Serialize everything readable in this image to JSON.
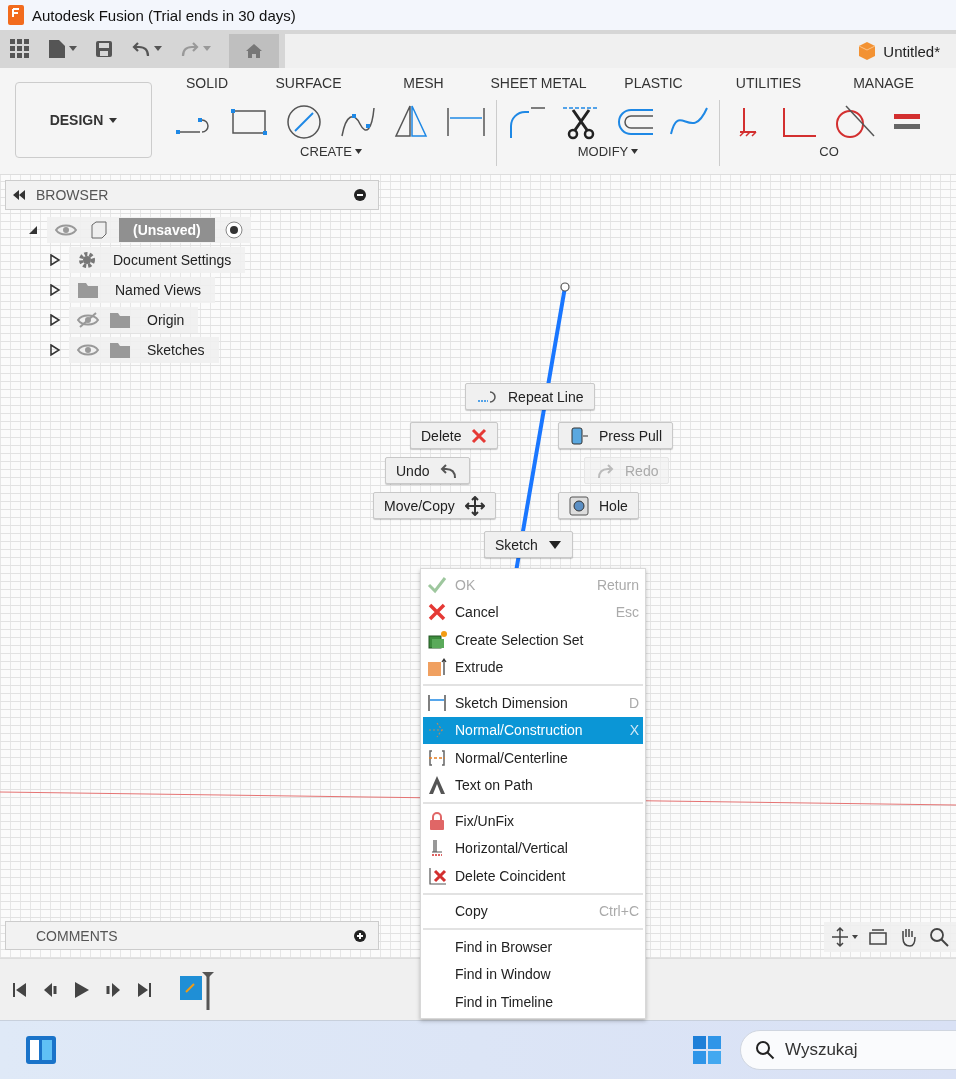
{
  "window": {
    "title": "Autodesk Fusion (Trial ends in 30 days)"
  },
  "document_tab": {
    "title": "Untitled*"
  },
  "workspace": {
    "label": "DESIGN"
  },
  "toolbar_tabs": [
    "SOLID",
    "SURFACE",
    "MESH",
    "SHEET METAL",
    "PLASTIC",
    "UTILITIES",
    "MANAGE"
  ],
  "toolbar_groups": [
    {
      "label": "CREATE"
    },
    {
      "label": "MODIFY"
    },
    {
      "label": "CO"
    }
  ],
  "browser": {
    "title": "BROWSER",
    "root": {
      "label": "(Unsaved)",
      "visible": true,
      "active": true,
      "expanded": true,
      "children": [
        {
          "label": "Document Settings",
          "expanded": false
        },
        {
          "label": "Named Views",
          "expanded": false
        },
        {
          "label": "Origin",
          "expanded": false,
          "visible": false
        },
        {
          "label": "Sketches",
          "expanded": false,
          "visible": true
        }
      ]
    }
  },
  "marking_menu": [
    {
      "label": "Repeat Line",
      "disabled": false
    },
    {
      "label": "Delete",
      "disabled": false
    },
    {
      "label": "Press Pull",
      "disabled": false
    },
    {
      "label": "Undo",
      "disabled": false
    },
    {
      "label": "Redo",
      "disabled": true
    },
    {
      "label": "Move/Copy",
      "disabled": false
    },
    {
      "label": "Hole",
      "disabled": false
    },
    {
      "label": "Sketch",
      "disabled": false
    }
  ],
  "context_menu": [
    [
      {
        "label": "OK",
        "shortcut": "Return",
        "disabled": true,
        "selected": false
      },
      {
        "label": "Cancel",
        "shortcut": "Esc",
        "disabled": false,
        "selected": false
      },
      {
        "label": "Create Selection Set",
        "disabled": false,
        "selected": false
      },
      {
        "label": "Extrude",
        "disabled": false,
        "selected": false
      }
    ],
    [
      {
        "label": "Sketch Dimension",
        "shortcut": "D",
        "disabled": false,
        "selected": false
      },
      {
        "label": "Normal/Construction",
        "shortcut": "X",
        "disabled": false,
        "selected": true
      },
      {
        "label": "Normal/Centerline",
        "disabled": false,
        "selected": false
      },
      {
        "label": "Text on Path",
        "disabled": false,
        "selected": false
      }
    ],
    [
      {
        "label": "Fix/UnFix",
        "disabled": false,
        "selected": false
      },
      {
        "label": "Horizontal/Vertical",
        "disabled": false,
        "selected": false
      },
      {
        "label": "Delete Coincident",
        "disabled": false,
        "selected": false
      }
    ],
    [
      {
        "label": "Copy",
        "shortcut": "Ctrl+C",
        "disabled": false,
        "selected": false
      }
    ],
    [
      {
        "label": "Find in Browser",
        "disabled": false,
        "selected": false
      },
      {
        "label": "Find in Window",
        "disabled": false,
        "selected": false
      },
      {
        "label": "Find in Timeline",
        "disabled": false,
        "selected": false
      }
    ]
  ],
  "comments": {
    "title": "COMMENTS"
  },
  "taskbar": {
    "search_placeholder": "Wyszukaj"
  }
}
